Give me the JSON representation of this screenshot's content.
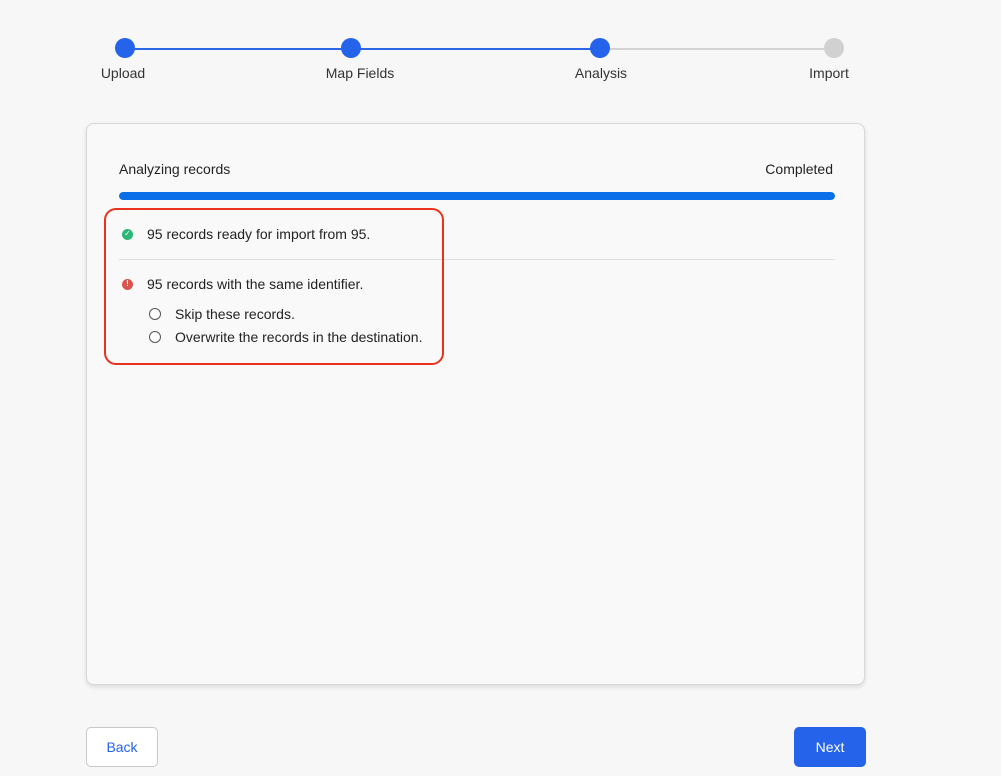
{
  "stepper": {
    "steps": [
      {
        "label": "Upload",
        "state": "done"
      },
      {
        "label": "Map Fields",
        "state": "done"
      },
      {
        "label": "Analysis",
        "state": "done"
      },
      {
        "label": "Import",
        "state": "todo"
      }
    ]
  },
  "analysis": {
    "progress_label": "Analyzing records",
    "status_label": "Completed",
    "progress_fraction": 1.0,
    "ready_message": "95 records ready for import from 95.",
    "duplicate_message": "95 records with the same identifier.",
    "options": [
      {
        "label": "Skip these records.",
        "selected": false
      },
      {
        "label": "Overwrite the records in the destination.",
        "selected": false
      }
    ]
  },
  "footer": {
    "back_label": "Back",
    "next_label": "Next"
  },
  "colors": {
    "accent": "#2563eb",
    "progress": "#0a6fe8",
    "success": "#2bb673",
    "error": "#d9534f",
    "highlight": "#e8321e"
  }
}
